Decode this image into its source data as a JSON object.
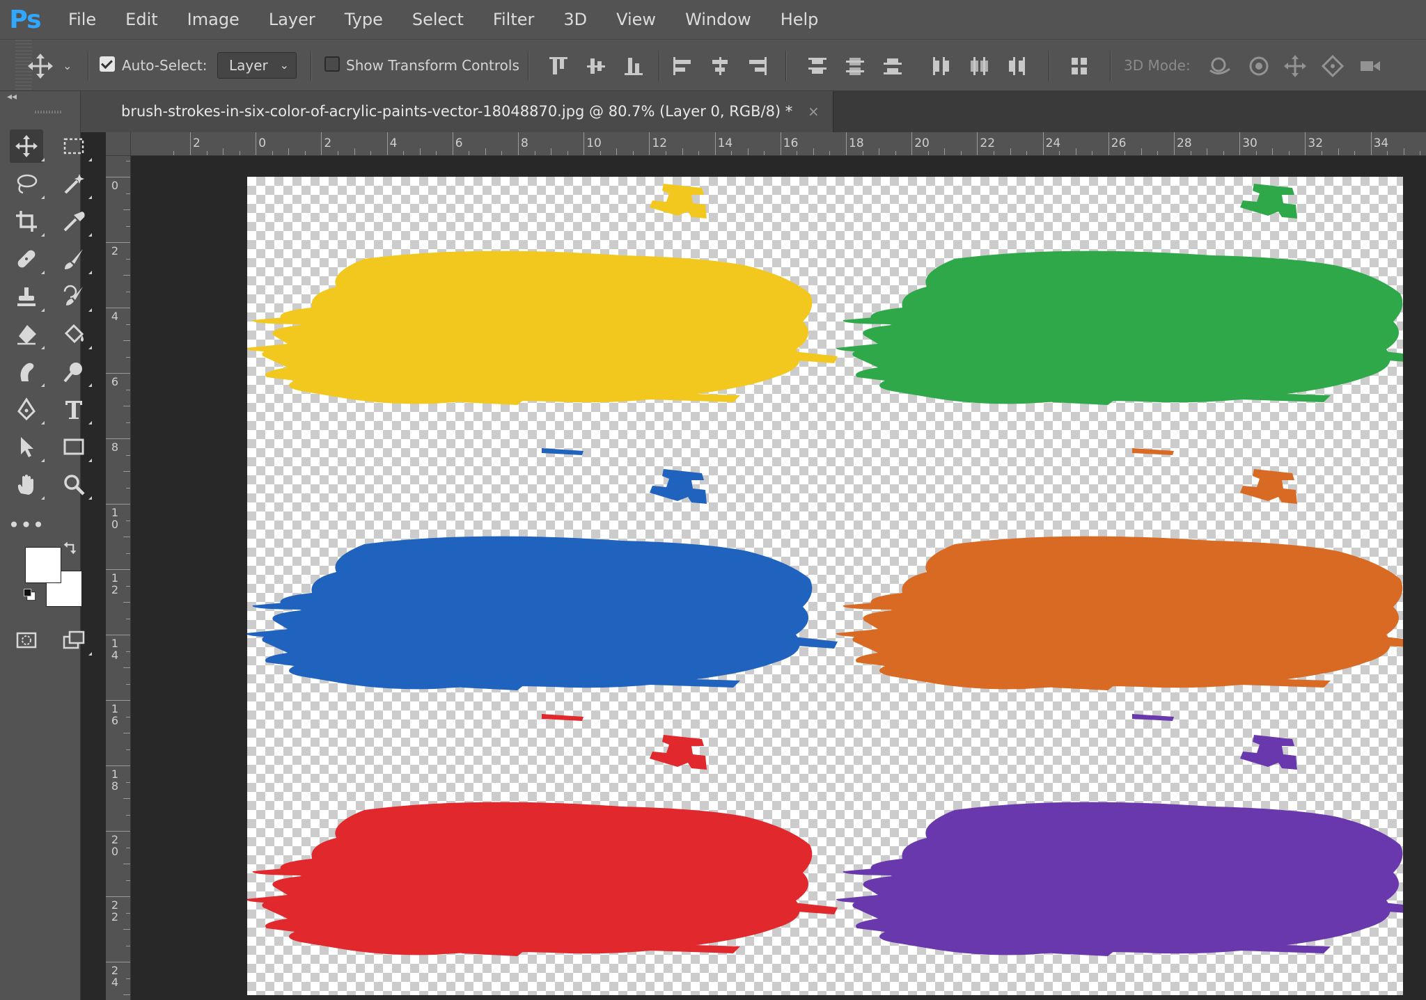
{
  "app": {
    "logo": "Ps"
  },
  "menu": [
    "File",
    "Edit",
    "Image",
    "Layer",
    "Type",
    "Select",
    "Filter",
    "3D",
    "View",
    "Window",
    "Help"
  ],
  "options_bar": {
    "move_icon": "move-icon",
    "auto_select_label": "Auto-Select:",
    "auto_select_checked": true,
    "auto_select_target": "Layer",
    "show_transform_label": "Show Transform Controls",
    "show_transform_checked": false,
    "mode_3d_label": "3D Mode:"
  },
  "document": {
    "tab_title": "brush-strokes-in-six-color-of-acrylic-paints-vector-18048870.jpg @ 80.7% (Layer 0, RGB/8) *",
    "close_glyph": "×"
  },
  "rulers": {
    "horizontal": [
      "2",
      "0",
      "2",
      "4",
      "6",
      "8",
      "10",
      "12",
      "14",
      "16",
      "18",
      "20",
      "22",
      "24",
      "26",
      "28",
      "30",
      "32",
      "34"
    ],
    "vertical": [
      "0",
      "2",
      "4",
      "6",
      "8",
      "10",
      "12",
      "14",
      "16",
      "18",
      "20",
      "22",
      "24"
    ]
  },
  "tools": [
    "move-tool",
    "marquee-tool",
    "lasso-tool",
    "magic-wand-tool",
    "crop-tool",
    "eyedropper-tool",
    "healing-tool",
    "brush-tool",
    "stamp-tool",
    "history-brush-tool",
    "eraser-tool",
    "paint-bucket-tool",
    "smudge-tool",
    "dodge-tool",
    "pen-tool",
    "type-tool",
    "path-selection-tool",
    "rectangle-tool",
    "hand-tool",
    "zoom-tool"
  ],
  "colors": {
    "foreground": "#ffffff",
    "background": "#ffffff"
  },
  "strokes": [
    {
      "name": "yellow",
      "color": "#f2c81e"
    },
    {
      "name": "green",
      "color": "#2fa84a"
    },
    {
      "name": "blue",
      "color": "#1f63bf"
    },
    {
      "name": "orange",
      "color": "#d86a23"
    },
    {
      "name": "red",
      "color": "#e0282d"
    },
    {
      "name": "purple",
      "color": "#6a38ad"
    }
  ]
}
